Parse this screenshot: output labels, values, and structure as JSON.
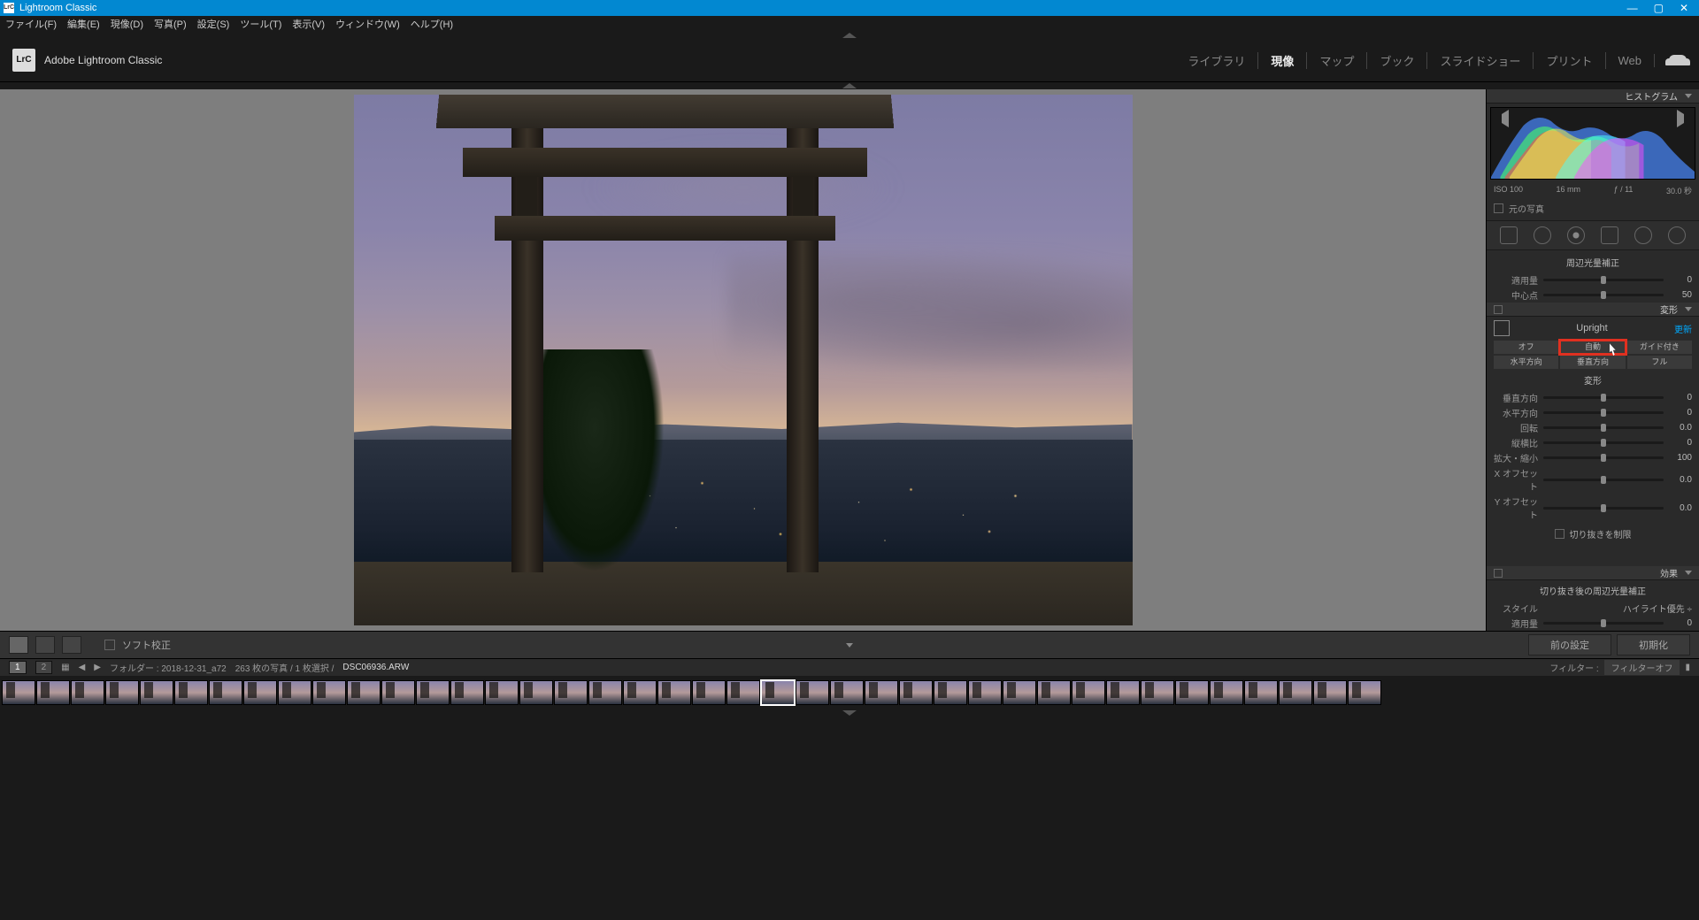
{
  "titlebar": {
    "app_name": "Lightroom Classic",
    "icon": "LrC"
  },
  "menubar": [
    "ファイル(F)",
    "編集(E)",
    "現像(D)",
    "写真(P)",
    "設定(S)",
    "ツール(T)",
    "表示(V)",
    "ウィンドウ(W)",
    "ヘルプ(H)"
  ],
  "identity": {
    "icon": "LrC",
    "name": "Adobe Lightroom Classic"
  },
  "modules": [
    "ライブラリ",
    "現像",
    "マップ",
    "ブック",
    "スライドショー",
    "プリント",
    "Web"
  ],
  "active_module": "現像",
  "panels": {
    "histogram": {
      "title": "ヒストグラム",
      "iso": "ISO 100",
      "focal": "16 mm",
      "aperture": "ƒ / 11",
      "shutter": "30.0 秒",
      "original": "元の写真"
    },
    "vignette": {
      "title": "周辺光量補正",
      "sliders": [
        {
          "label": "適用量",
          "val": "0",
          "pos": 50
        },
        {
          "label": "中心点",
          "val": "50",
          "pos": 50
        }
      ]
    },
    "transform": {
      "title": "変形",
      "upright": "Upright",
      "update": "更新",
      "row1": [
        "オフ",
        "自動",
        "ガイド付き"
      ],
      "row2": [
        "水平方向",
        "垂直方向",
        "フル"
      ],
      "subhead": "変形",
      "sliders": [
        {
          "label": "垂直方向",
          "val": "0",
          "pos": 50
        },
        {
          "label": "水平方向",
          "val": "0",
          "pos": 50
        },
        {
          "label": "回転",
          "val": "0.0",
          "pos": 50
        },
        {
          "label": "縦横比",
          "val": "0",
          "pos": 50
        },
        {
          "label": "拡大・縮小",
          "val": "100",
          "pos": 50
        },
        {
          "label": "X オフセット",
          "val": "0.0",
          "pos": 50
        },
        {
          "label": "Y オフセット",
          "val": "0.0",
          "pos": 50
        }
      ],
      "constrain": "切り抜きを制限"
    },
    "effects": {
      "title": "効果",
      "sub": "切り抜き後の周辺光量補正",
      "style_lbl": "スタイル",
      "style_val": "ハイライト優先",
      "amount": {
        "label": "適用量",
        "val": "0",
        "pos": 50
      }
    }
  },
  "toolbar": {
    "soft": "ソフト校正",
    "prev": "前の設定",
    "reset": "初期化"
  },
  "status": {
    "pages": [
      "1",
      "2"
    ],
    "path": "フォルダー : 2018-12-31_a72",
    "count": "263 枚の写真 / 1 枚選択 /",
    "file": "DSC06936.ARW",
    "filter_lbl": "フィルター :",
    "filter_val": "フィルターオフ"
  },
  "filmstrip_count": 40,
  "filmstrip_selected": 22
}
